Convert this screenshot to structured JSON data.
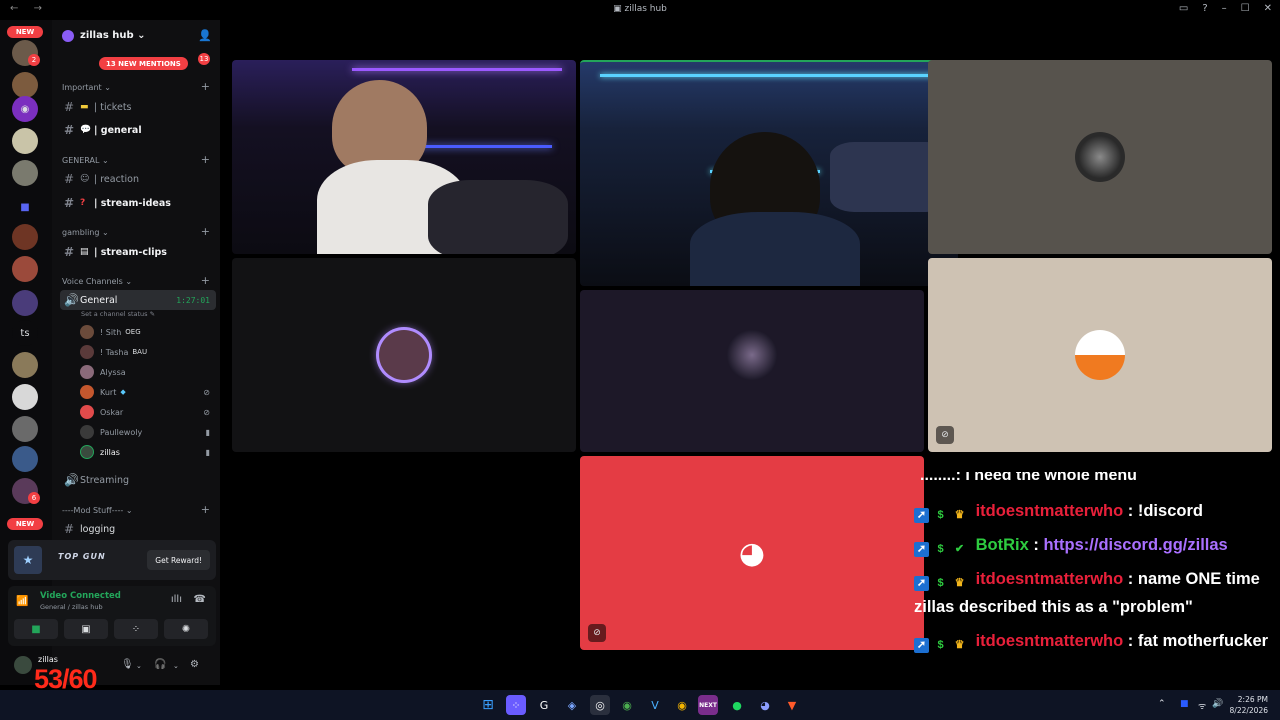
{
  "window": {
    "title": "zillas hub",
    "back_icon": "arrow-left-icon",
    "forward_icon": "arrow-right-icon"
  },
  "rail": {
    "new_top": "NEW",
    "new_bottom": "NEW",
    "badge_1": "2",
    "badge_2": "6",
    "text_server": "ts"
  },
  "sidebar": {
    "guild_name": "zillas hub",
    "mentions": "13 NEW MENTIONS",
    "mentions_count": "13",
    "categories": {
      "important": "Important",
      "general": "GENERAL",
      "gambling": "gambling",
      "voice": "Voice Channels",
      "mod": "----Mod Stuff----"
    },
    "channels": {
      "tickets": "| tickets",
      "general": "| general",
      "reaction": "| reaction",
      "stream_ideas": "| stream-ideas",
      "stream_clips": "| stream-clips",
      "voice_general": "General",
      "voice_timer": "1:27:01",
      "voice_status": "Set a channel status",
      "streaming": "Streaming",
      "logging": "logging"
    },
    "voice_users": [
      {
        "name": "! Sith",
        "tag": "OEG"
      },
      {
        "name": "! Tasha",
        "tag": "BAU"
      },
      {
        "name": "Alyssa",
        "tag": ""
      },
      {
        "name": "Kurt",
        "tag": ""
      },
      {
        "name": "Oskar",
        "tag": ""
      },
      {
        "name": "Paullewoly",
        "tag": ""
      },
      {
        "name": "zillas",
        "tag": ""
      }
    ]
  },
  "promo": {
    "logo": "TOP GUN",
    "reward": "Get Reward!"
  },
  "voice_panel": {
    "title": "Video Connected",
    "subtitle": "General / zillas hub"
  },
  "user": {
    "name": "zillas"
  },
  "overlay": {
    "fps": "53/60"
  },
  "chat": {
    "cut_line": "........: I need the whole menu",
    "messages": [
      {
        "user": "itdoesntmatterwho",
        "text": ": !discord",
        "user_color": "red"
      },
      {
        "user": "BotRix",
        "text": ": ",
        "link": "https://discord.gg/zillas",
        "user_color": "green"
      },
      {
        "user": "itdoesntmatterwho",
        "text": ": name ONE time zillas described this as a \"problem\"",
        "user_color": "red"
      },
      {
        "user": "itdoesntmatterwho",
        "text": ": fat motherfucker",
        "user_color": "red"
      }
    ]
  },
  "taskbar": {
    "time": "2:26 PM",
    "date": "8/22/2026",
    "next_label": "NEXT"
  }
}
